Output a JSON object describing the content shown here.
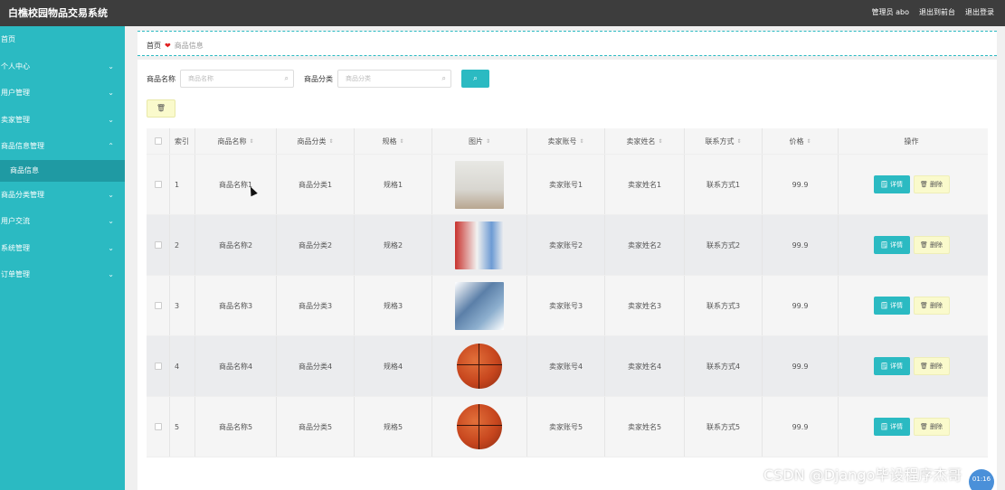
{
  "app": {
    "title": "白樵校园物品交易系统",
    "admin_label": "管理员 abo",
    "exit_to_front": "退出到前台",
    "logout": "退出登录"
  },
  "sidebar": {
    "items": [
      {
        "label": "首页",
        "has_chevron": false
      },
      {
        "label": "个人中心",
        "has_chevron": true
      },
      {
        "label": "用户管理",
        "has_chevron": true
      },
      {
        "label": "卖家管理",
        "has_chevron": true
      },
      {
        "label": "商品信息管理",
        "has_chevron": true,
        "expanded": true
      },
      {
        "label": "商品信息",
        "sub": true
      },
      {
        "label": "商品分类管理",
        "has_chevron": true
      },
      {
        "label": "用户交流",
        "has_chevron": true
      },
      {
        "label": "系统管理",
        "has_chevron": true
      },
      {
        "label": "订单管理",
        "has_chevron": true
      }
    ]
  },
  "breadcrumb": {
    "home": "首页",
    "separator": "❤",
    "current": "商品信息"
  },
  "search": {
    "name_label": "商品名称",
    "name_placeholder": "商品名称",
    "category_label": "商品分类",
    "category_placeholder": "商品分类",
    "search_button": "⌕"
  },
  "batch_delete_label": "🗑",
  "table": {
    "headers": {
      "index": "索引",
      "name": "商品名称",
      "category": "商品分类",
      "spec": "规格",
      "image": "图片",
      "seller_account": "卖家账号",
      "seller_name": "卖家姓名",
      "contact": "联系方式",
      "price": "价格",
      "ops": "操作"
    },
    "detail_label": "🗒 详情",
    "delete_label": "🗑 删除",
    "rows": [
      {
        "index": "1",
        "name": "商品名称1",
        "category": "商品分类1",
        "spec": "规格1",
        "image": "photo-person",
        "seller_account": "卖家账号1",
        "seller_name": "卖家姓名1",
        "contact": "联系方式1",
        "price": "99.9"
      },
      {
        "index": "2",
        "name": "商品名称2",
        "category": "商品分类2",
        "spec": "规格2",
        "image": "photo-milk",
        "seller_account": "卖家账号2",
        "seller_name": "卖家姓名2",
        "contact": "联系方式2",
        "price": "99.9"
      },
      {
        "index": "3",
        "name": "商品名称3",
        "category": "商品分类3",
        "spec": "规格3",
        "image": "photo-book",
        "seller_account": "卖家账号3",
        "seller_name": "卖家姓名3",
        "contact": "联系方式3",
        "price": "99.9"
      },
      {
        "index": "4",
        "name": "商品名称4",
        "category": "商品分类4",
        "spec": "规格4",
        "image": "photo-basketball",
        "seller_account": "卖家账号4",
        "seller_name": "卖家姓名4",
        "contact": "联系方式4",
        "price": "99.9"
      },
      {
        "index": "5",
        "name": "商品名称5",
        "category": "商品分类5",
        "spec": "规格5",
        "image": "photo-basketball",
        "seller_account": "卖家账号5",
        "seller_name": "卖家姓名5",
        "contact": "联系方式5",
        "price": "99.9"
      }
    ]
  },
  "watermark": "CSDN @Django毕设程序杰哥",
  "timer": "01:16",
  "colors": {
    "accent": "#2bbac2",
    "topbar": "#3d3d3d",
    "delete_bg": "#fafacc"
  }
}
